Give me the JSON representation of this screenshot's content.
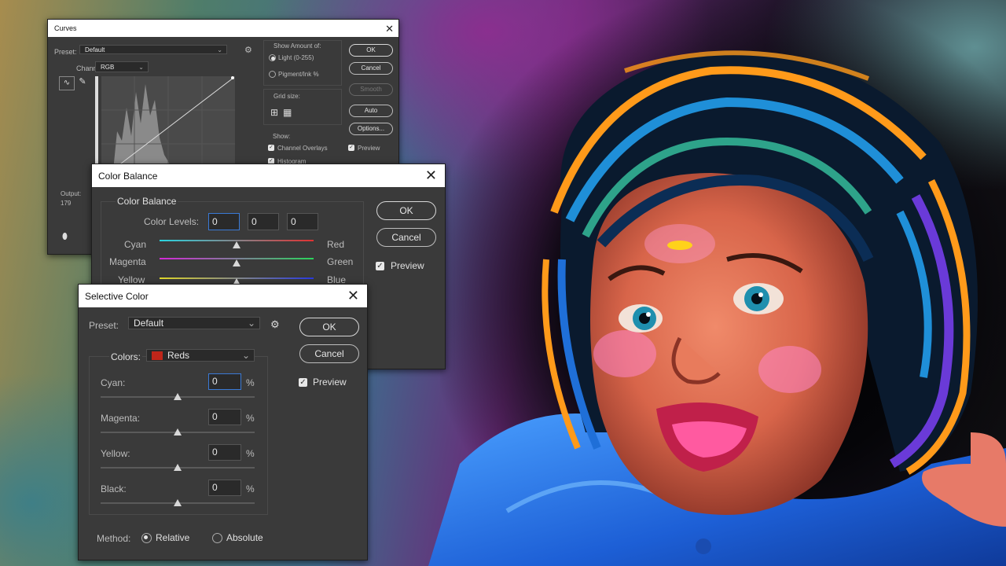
{
  "curves": {
    "title": "Curves",
    "preset_label": "Preset:",
    "preset_value": "Default",
    "channel_label": "Channel:",
    "channel_value": "RGB",
    "show_amount_label": "Show Amount of:",
    "light_option": "Light  (0-255)",
    "pigment_option": "Pigment/Ink %",
    "grid_size_label": "Grid size:",
    "show_label": "Show:",
    "channel_overlays": "Channel Overlays",
    "histogram": "Histogram",
    "preview": "Preview",
    "ok": "OK",
    "cancel": "Cancel",
    "smooth": "Smooth",
    "auto": "Auto",
    "options": "Options...",
    "output_label": "Output:",
    "output_value": "179"
  },
  "color_balance": {
    "title": "Color Balance",
    "group_label": "Color Balance",
    "levels_label": "Color Levels:",
    "levels": [
      "0",
      "0",
      "0"
    ],
    "sliders": [
      {
        "left": "Cyan",
        "right": "Red",
        "value": 0
      },
      {
        "left": "Magenta",
        "right": "Green",
        "value": 0
      },
      {
        "left": "Yellow",
        "right": "Blue",
        "value": 0
      }
    ],
    "ok": "OK",
    "cancel": "Cancel",
    "preview": "Preview"
  },
  "selective_color": {
    "title": "Selective Color",
    "preset_label": "Preset:",
    "preset_value": "Default",
    "colors_label": "Colors:",
    "colors_value": "Reds",
    "swatch_color": "#c0261a",
    "sliders": [
      {
        "label": "Cyan:",
        "value": "0",
        "unit": "%"
      },
      {
        "label": "Magenta:",
        "value": "0",
        "unit": "%"
      },
      {
        "label": "Yellow:",
        "value": "0",
        "unit": "%"
      },
      {
        "label": "Black:",
        "value": "0",
        "unit": "%"
      }
    ],
    "method_label": "Method:",
    "relative": "Relative",
    "absolute": "Absolute",
    "ok": "OK",
    "cancel": "Cancel",
    "preview": "Preview"
  }
}
